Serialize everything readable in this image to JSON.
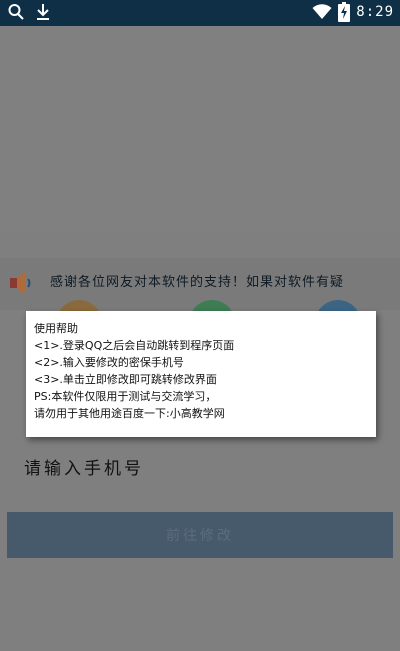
{
  "status_bar": {
    "time": "8:29",
    "left_icons": [
      "search-icon",
      "download-icon"
    ],
    "right_icons": [
      "wifi-icon",
      "battery-charging-icon"
    ]
  },
  "marquee": {
    "text": "感谢各位网友对本软件的支持！如果对软件有疑"
  },
  "feature_circles": [
    {
      "color": "#8a6a3d"
    },
    {
      "color": "#3e7c54"
    },
    {
      "color": "#3c6585"
    }
  ],
  "form": {
    "phone_placeholder": "请输入手机号",
    "submit_label": "前往修改"
  },
  "help_dialog": {
    "title": "使用帮助",
    "lines": [
      "<1>.登录QQ之后会自动跳转到程序页面",
      "<2>.输入要修改的密保手机号",
      "<3>.单击立即修改即可跳转修改界面",
      "PS:本软件仅限用于测试与交流学习，",
      "请勿用于其他用途百度一下:小高教学网"
    ]
  },
  "colors": {
    "status_bar_bg": "#0f2f47",
    "overlay_bg": "#7f7f7f",
    "button_bg": "#465a6b",
    "dialog_bg": "#ffffff"
  }
}
